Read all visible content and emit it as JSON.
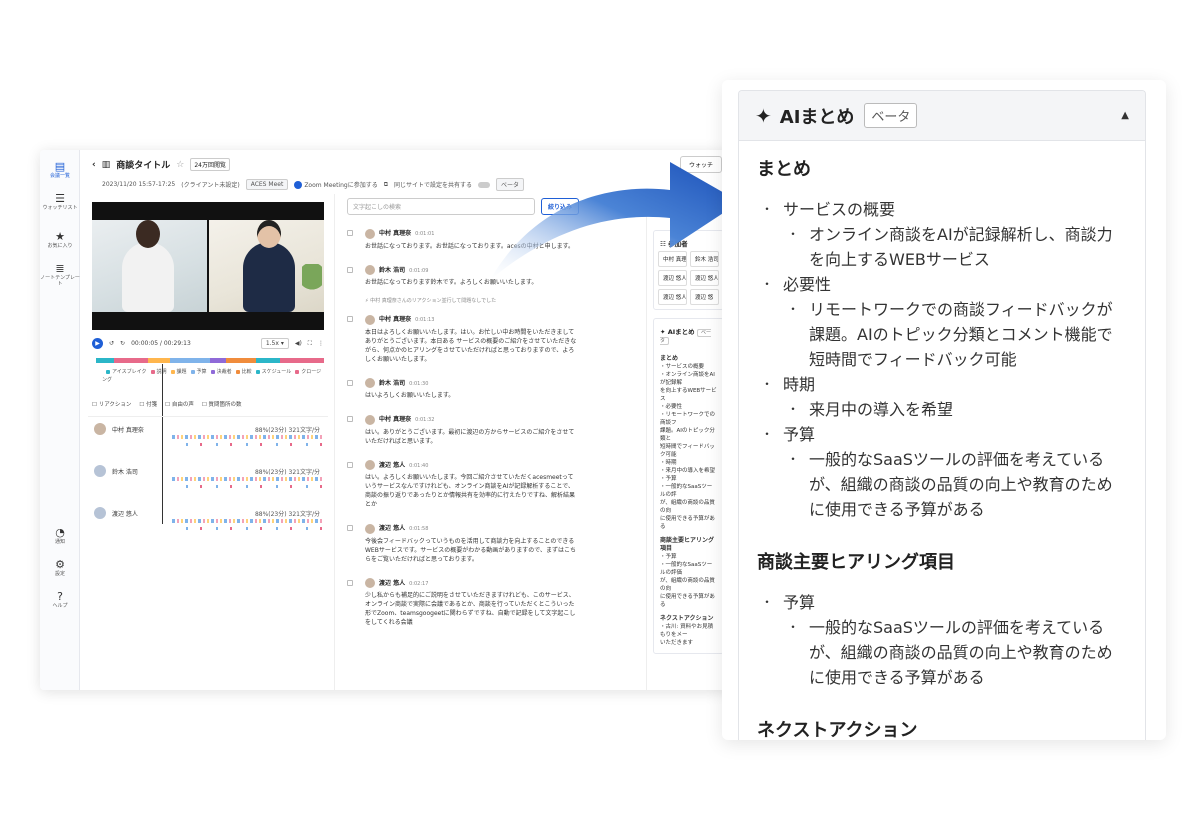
{
  "rail": {
    "items": [
      {
        "label": "会議一覧",
        "icon": "calendar-icon"
      },
      {
        "label": "ウォッチリスト",
        "icon": "list-icon"
      },
      {
        "label": "お気に入り",
        "icon": "star-icon"
      },
      {
        "label": "ノートテンプレート",
        "icon": "stack-icon"
      }
    ],
    "bottom": [
      {
        "label": "通知",
        "icon": "bell-icon"
      },
      {
        "label": "設定",
        "icon": "gear-icon"
      },
      {
        "label": "ヘルプ",
        "icon": "help-icon"
      }
    ]
  },
  "header": {
    "title": "商談タイトル",
    "views_badge": "24万回閲覧",
    "datetime": "2023/11/20 15:57-17:25",
    "client": "(クライアント未設定)",
    "service_chip": "ACES Meet",
    "zoom_join": "Zoom Meetingに参加する",
    "same_site_toggle": "同じサイトで設定を共有する",
    "beta": "ベータ",
    "watch_button": "ウォッチ"
  },
  "player": {
    "time": "00:00:05 / 00:29:13",
    "speed": "1.5x"
  },
  "timeline_legend": [
    "アイスブレイク",
    "説明",
    "課題",
    "予算",
    "決裁者",
    "比較",
    "スケジュール",
    "クロージング"
  ],
  "timeline_colors": [
    "#2bb6c8",
    "#e76a8a",
    "#ffb64d",
    "#7fb3ea",
    "#8f6ad8",
    "#f08c3c"
  ],
  "filters": [
    "リアクション",
    "付箋",
    "自由の声",
    "質問箇所の数"
  ],
  "speakers": [
    {
      "name": "中村 真理奈",
      "stat": "88%(23分)",
      "chars": "321文字/分"
    },
    {
      "name": "鈴木 浩司",
      "stat": "88%(23分)",
      "chars": "321文字/分"
    },
    {
      "name": "渡辺 悠人",
      "stat": "88%(23分)",
      "chars": "321文字/分"
    }
  ],
  "transcript": {
    "search_placeholder": "文字起こしの検索",
    "search_button": "絞り込み",
    "reaction_note": "中村 真理奈さんのリアクション並行して問題なしでした",
    "messages": [
      {
        "name": "中村 真理奈",
        "time": "0:01:01",
        "text": "お世話になっております。お世話になっております。acesの中村と申します。"
      },
      {
        "name": "鈴木 浩司",
        "time": "0:01:09",
        "text": "お世話になっております鈴木です。よろしくお願いいたします。"
      },
      {
        "name": "中村 真理奈",
        "time": "0:01:13",
        "text": "本日はよろしくお願いいたします。はい。お忙しい中お時間をいただきましてありがとうございます。本日ある サービスの概要のご紹介をさせていただきながら、何点かのヒアリングをさせていただければと思っておりますので、よろしくお願いいたします。"
      },
      {
        "name": "鈴木 浩司",
        "time": "0:01:30",
        "text": "はいよろしくお願いいたします。"
      },
      {
        "name": "中村 真理奈",
        "time": "0:01:32",
        "text": "はい。ありがとうございます。最初に渡辺の方からサービスのご紹介をさせていただければと思います。"
      },
      {
        "name": "渡辺 悠人",
        "time": "0:01:40",
        "text": "はい。よろしくお願いいたします。今回ご紹介させていただくacesmeetっていうサービスなんですけれども、オンライン商談をAIが記録解析することで、商談の振り返りであったりとか情報共有を効率的に行えたりですね、解析結果とか"
      },
      {
        "name": "渡辺 悠人",
        "time": "0:01:58",
        "text": "今後会フィードバックっていうものを活用して商談力を向上することのできるWEBサービスです。サービスの概要がわかる動画がありますので、まずはこちらをご覧いただければと思っております。"
      },
      {
        "name": "渡辺 悠人",
        "time": "0:02:17",
        "text": "少し私からも補足的にご説明をさせていただきますけれども、このサービス、オンライン商談で実際に会議であるとか、商談を行っていただくとこういった形でZoom、teamsgoogeetに関わらずですね、自動で記録をして文字起こしをしてくれる会議"
      }
    ]
  },
  "side": {
    "participants_title": "参加者",
    "participants": [
      "中村 真理奈",
      "鈴木 浩司",
      "渡辺 悠人",
      "渡辺 悠人",
      "渡辺 悠人",
      "渡辺 悠"
    ],
    "ai_title": "AIまとめ",
    "beta": "ベータ",
    "mini_sections": [
      {
        "title": "まとめ",
        "lines": [
          "・サービスの概要",
          "・オンライン商談をAIが記録解",
          "を向上するWEBサービス",
          "・必要性",
          "・リモートワークでの商談フ",
          "課題。AIのトピック分類と",
          "短時間でフィードバック可能",
          "・時期",
          "・来月中の導入を希望",
          "・予算",
          "・一般的なSaaSツールの評",
          "が、組織の商談の品質の向",
          "に使用できる予算がある"
        ]
      },
      {
        "title": "商談主要ヒアリング項目",
        "lines": [
          "・予算",
          "・一般的なSaaSツールの評価",
          "が、組織の商談の品質の向",
          "に使用できる予算がある"
        ]
      },
      {
        "title": "ネクストアクション",
        "lines": [
          "・古川: 資料やお見積もりをメー",
          "いただきます"
        ]
      }
    ]
  },
  "ai_panel": {
    "title": "AIまとめ",
    "beta": "ベータ",
    "sections": [
      {
        "title": "まとめ",
        "items": [
          {
            "label": "サービスの概要",
            "sub": [
              "オンライン商談をAIが記録解析し、商談力を向上するWEBサービス"
            ]
          },
          {
            "label": "必要性",
            "sub": [
              "リモートワークでの商談フィードバックが課題。AIのトピック分類とコメント機能で短時間でフィードバック可能"
            ]
          },
          {
            "label": "時期",
            "sub": [
              "来月中の導入を希望"
            ]
          },
          {
            "label": "予算",
            "sub": [
              "一般的なSaaSツールの評価を考えているが、組織の商談の品質の向上や教育のために使用できる予算がある"
            ]
          }
        ]
      },
      {
        "title": "商談主要ヒアリング項目",
        "items": [
          {
            "label": "予算",
            "sub": [
              "一般的なSaaSツールの評価を考えているが、組織の商談の品質の向上や教育のために使用できる予算がある"
            ]
          }
        ]
      },
      {
        "title": "ネクストアクション",
        "items": []
      }
    ]
  }
}
